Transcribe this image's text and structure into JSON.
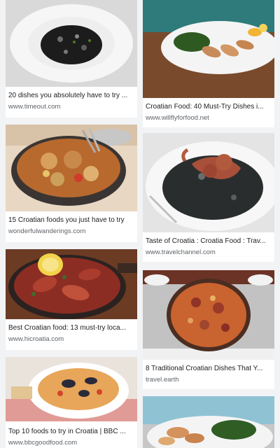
{
  "results": [
    {
      "title": "20 dishes you absolutely have to try ...",
      "source": "www.timeout.com",
      "image": "black-risotto-bowl"
    },
    {
      "title": "15 Croatian foods you just have to try",
      "source": "wonderfulwanderings.com",
      "image": "chicken-peka-pan"
    },
    {
      "title": "Best Croatian food: 13 must-try loca...",
      "source": "www.hicroatia.com",
      "image": "sausage-skillet-lemon"
    },
    {
      "title": "Top 10 foods to try in Croatia | BBC ...",
      "source": "www.bbcgoodfood.com",
      "image": "mussel-pasta-bowl"
    },
    {
      "title": "Croatian Food: 40 Must-Try Dishes i...",
      "source": "www.willflyforfood.net",
      "image": "grilled-squid-plate"
    },
    {
      "title": "Taste of Croatia : Croatia Food : Trav...",
      "source": "www.travelchannel.com",
      "image": "octopus-black-risotto"
    },
    {
      "title": "8 Traditional Croatian Dishes That Y...",
      "source": "travel.earth",
      "image": "octopus-peka-pan"
    },
    {
      "title": "",
      "source": "",
      "image": "seafood-greens-plate"
    }
  ]
}
